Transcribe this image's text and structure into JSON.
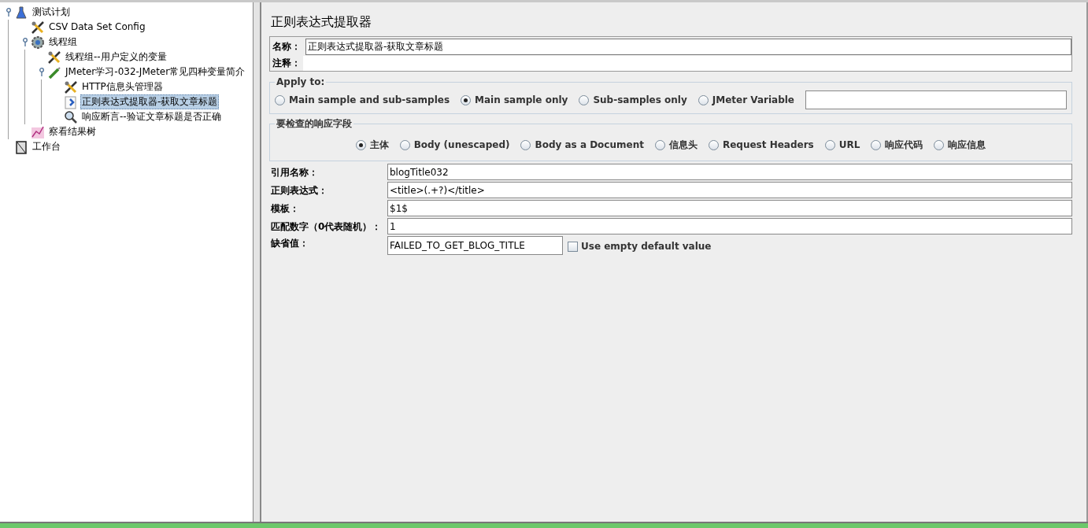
{
  "tree": [
    {
      "label": "测试计划",
      "kind": "plan",
      "selected": false,
      "expanded": true,
      "children": [
        {
          "label": "CSV Data Set Config",
          "kind": "config",
          "selected": false
        },
        {
          "label": "线程组",
          "kind": "threadgroup",
          "selected": false,
          "expanded": true,
          "children": [
            {
              "label": "线程组--用户定义的变量",
              "kind": "config",
              "selected": false
            },
            {
              "label": "JMeter学习-032-JMeter常见四种变量简介",
              "kind": "sampler",
              "selected": false,
              "expanded": true,
              "children": [
                {
                  "label": "HTTP信息头管理器",
                  "kind": "config",
                  "selected": false
                },
                {
                  "label": "正则表达式提取器-获取文章标题",
                  "kind": "extractor",
                  "selected": true
                },
                {
                  "label": "响应断言--验证文章标题是否正确",
                  "kind": "assertion",
                  "selected": false
                }
              ]
            }
          ]
        },
        {
          "label": "察看结果树",
          "kind": "listener",
          "selected": false
        }
      ]
    },
    {
      "label": "工作台",
      "kind": "workbench",
      "selected": false
    }
  ],
  "panel": {
    "title": "正则表达式提取器",
    "name": {
      "label": "名称：",
      "value": "正则表达式提取器-获取文章标题"
    },
    "comment": {
      "label": "注释："
    },
    "apply_to": {
      "legend": "Apply to:",
      "options": [
        {
          "label": "Main sample and sub-samples",
          "selected": false
        },
        {
          "label": "Main sample only",
          "selected": true
        },
        {
          "label": "Sub-samples only",
          "selected": false
        },
        {
          "label": "JMeter Variable",
          "selected": false
        }
      ]
    },
    "field_to_check": {
      "legend": "要检查的响应字段",
      "options": [
        {
          "label": "主体",
          "selected": true
        },
        {
          "label": "Body (unescaped)",
          "selected": false
        },
        {
          "label": "Body as a Document",
          "selected": false
        },
        {
          "label": "信息头",
          "selected": false
        },
        {
          "label": "Request Headers",
          "selected": false
        },
        {
          "label": "URL",
          "selected": false
        },
        {
          "label": "响应代码",
          "selected": false
        },
        {
          "label": "响应信息",
          "selected": false
        }
      ]
    },
    "fields": [
      {
        "label": "引用名称：",
        "value": "blogTitle032"
      },
      {
        "label": "正则表达式：",
        "value": "<title>(.+?)</title>"
      },
      {
        "label": "模板：",
        "value": "$1$"
      },
      {
        "label": "匹配数字（0代表随机）：",
        "value": "1"
      }
    ],
    "default": {
      "label": "缺省值：",
      "value": "FAILED_TO_GET_BLOG_TITLE",
      "checkbox": {
        "label": "Use empty default value",
        "checked": false
      }
    }
  }
}
